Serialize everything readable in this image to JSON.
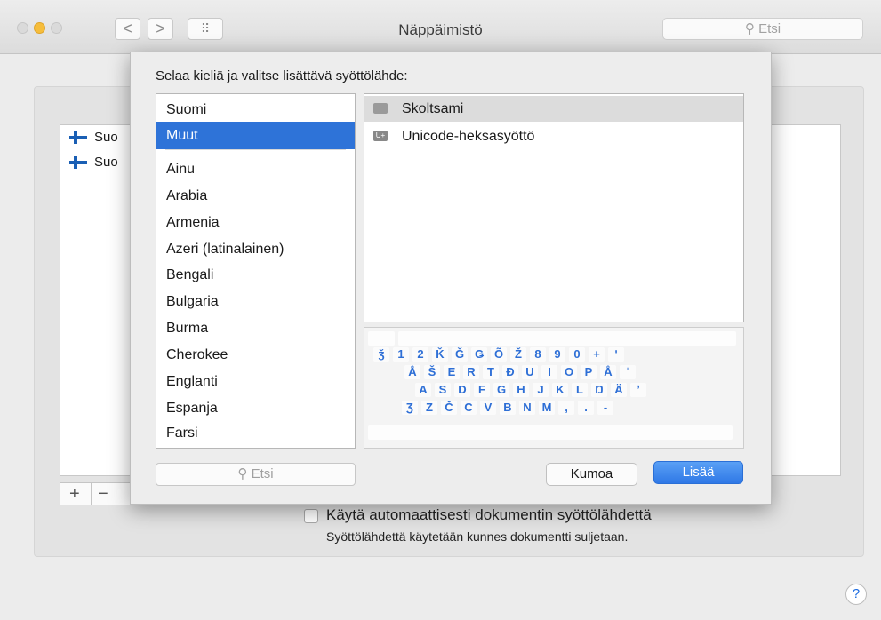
{
  "window": {
    "title": "Näppäimistö",
    "search_placeholder": "Etsi",
    "back_glyph": "<",
    "forward_glyph": ">",
    "grid_glyph": "⠿"
  },
  "background": {
    "input_sources": [
      {
        "label": "Suo",
        "icon": "finnish-flag-icon"
      },
      {
        "label": "Suo",
        "icon": "finnish-sami-flag-icon"
      }
    ],
    "plus_label": "+",
    "minus_label": "−",
    "auto_switch_label": "Käytä automaattisesti dokumentin syöttölähdettä",
    "auto_switch_note": "Syöttölähdettä käytetään kunnes dokumentti suljetaan.",
    "help_label": "?"
  },
  "sheet": {
    "title": "Selaa kieliä ja valitse lisättävä syöttölähde:",
    "languages": [
      "Suomi",
      "Muut",
      "Ainu",
      "Arabia",
      "Armenia",
      "Azeri (latinalainen)",
      "Bengali",
      "Bulgaria",
      "Burma",
      "Cherokee",
      "Englanti",
      "Espanja",
      "Farsi"
    ],
    "selected_language": "Muut",
    "sources": [
      {
        "label": "Skoltsami",
        "icon": "keyboard-icon"
      },
      {
        "label": "Unicode-heksasyöttö",
        "icon": "unicode-icon",
        "icon_text": "U+"
      }
    ],
    "keyboard_rows": [
      [
        "ǯ",
        "1",
        "2",
        "Ǩ",
        "Ǧ",
        "Ǥ",
        "Õ",
        "Ž",
        "8",
        "9",
        "0",
        "+",
        "ʹ"
      ],
      [
        "Å",
        "Š",
        "E",
        "R",
        "T",
        "Đ",
        "U",
        "I",
        "O",
        "P",
        "Å",
        "ˈ"
      ],
      [
        "A",
        "S",
        "D",
        "F",
        "G",
        "H",
        "J",
        "K",
        "L",
        "Ŋ",
        "Ä",
        "ʼ"
      ],
      [
        "Ʒ",
        "Z",
        "Č",
        "C",
        "V",
        "B",
        "N",
        "M",
        ",",
        ".",
        "-"
      ]
    ],
    "search_placeholder": "Etsi",
    "cancel_label": "Kumoa",
    "add_label": "Lisää"
  },
  "colors": {
    "accent": "#2e73d8",
    "key_text": "#2e6fd6"
  }
}
